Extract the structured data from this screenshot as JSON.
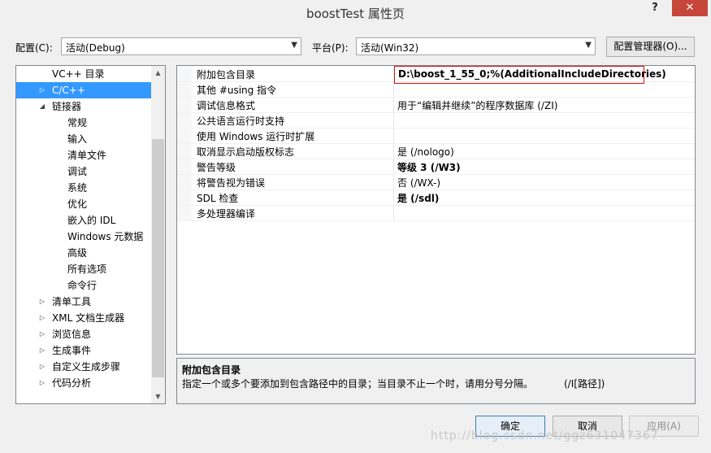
{
  "window": {
    "title": "boostTest 属性页",
    "help_label": "?",
    "close_label": "✕"
  },
  "toolbar": {
    "config_label": "配置(C):",
    "config_value": "活动(Debug)",
    "platform_label": "平台(P):",
    "platform_value": "活动(Win32)",
    "config_manager_label": "配置管理器(O)..."
  },
  "tree": {
    "items": [
      {
        "label": "VC++ 目录",
        "level": 1,
        "expander": "none"
      },
      {
        "label": "C/C++",
        "level": 1,
        "expander": "collapsed",
        "selected": true
      },
      {
        "label": "链接器",
        "level": 1,
        "expander": "expanded"
      },
      {
        "label": "常规",
        "level": 2,
        "expander": "none"
      },
      {
        "label": "输入",
        "level": 2,
        "expander": "none"
      },
      {
        "label": "清单文件",
        "level": 2,
        "expander": "none"
      },
      {
        "label": "调试",
        "level": 2,
        "expander": "none"
      },
      {
        "label": "系统",
        "level": 2,
        "expander": "none"
      },
      {
        "label": "优化",
        "level": 2,
        "expander": "none"
      },
      {
        "label": "嵌入的 IDL",
        "level": 2,
        "expander": "none"
      },
      {
        "label": "Windows 元数据",
        "level": 2,
        "expander": "none"
      },
      {
        "label": "高级",
        "level": 2,
        "expander": "none"
      },
      {
        "label": "所有选项",
        "level": 2,
        "expander": "none"
      },
      {
        "label": "命令行",
        "level": 2,
        "expander": "none"
      },
      {
        "label": "清单工具",
        "level": 1,
        "expander": "collapsed"
      },
      {
        "label": "XML 文档生成器",
        "level": 1,
        "expander": "collapsed"
      },
      {
        "label": "浏览信息",
        "level": 1,
        "expander": "collapsed"
      },
      {
        "label": "生成事件",
        "level": 1,
        "expander": "collapsed"
      },
      {
        "label": "自定义生成步骤",
        "level": 1,
        "expander": "collapsed"
      },
      {
        "label": "代码分析",
        "level": 1,
        "expander": "collapsed"
      }
    ]
  },
  "grid": {
    "rows": [
      {
        "name": "附加包含目录",
        "value": "D:\\boost_1_55_0;%(AdditionalIncludeDirectories)",
        "bold": true,
        "highlight": true
      },
      {
        "name": "其他 #using 指令",
        "value": "",
        "bold": false
      },
      {
        "name": "调试信息格式",
        "value": "用于“编辑并继续”的程序数据库 (/ZI)",
        "bold": false
      },
      {
        "name": "公共语言运行时支持",
        "value": "",
        "bold": false
      },
      {
        "name": "使用 Windows 运行时扩展",
        "value": "",
        "bold": false
      },
      {
        "name": "取消显示启动版权标志",
        "value": "是 (/nologo)",
        "bold": false
      },
      {
        "name": "警告等级",
        "value": "等级 3 (/W3)",
        "bold": true
      },
      {
        "name": "将警告视为错误",
        "value": "否 (/WX-)",
        "bold": false
      },
      {
        "name": "SDL 检查",
        "value": "是 (/sdl)",
        "bold": true
      },
      {
        "name": "多处理器编译",
        "value": "",
        "bold": false
      }
    ]
  },
  "description": {
    "title": "附加包含目录",
    "text": "指定一个或多个要添加到包含路径中的目录；当目录不止一个时，请用分号分隔。",
    "switch": "(/I[路径])"
  },
  "buttons": {
    "ok": "确定",
    "cancel": "取消",
    "apply": "应用(A)"
  },
  "watermark": "http://blog.csdn.net/ggz631047367",
  "colors": {
    "selection": "#3399ff",
    "highlight_border": "#dd1111",
    "close_button": "#c7463b"
  }
}
